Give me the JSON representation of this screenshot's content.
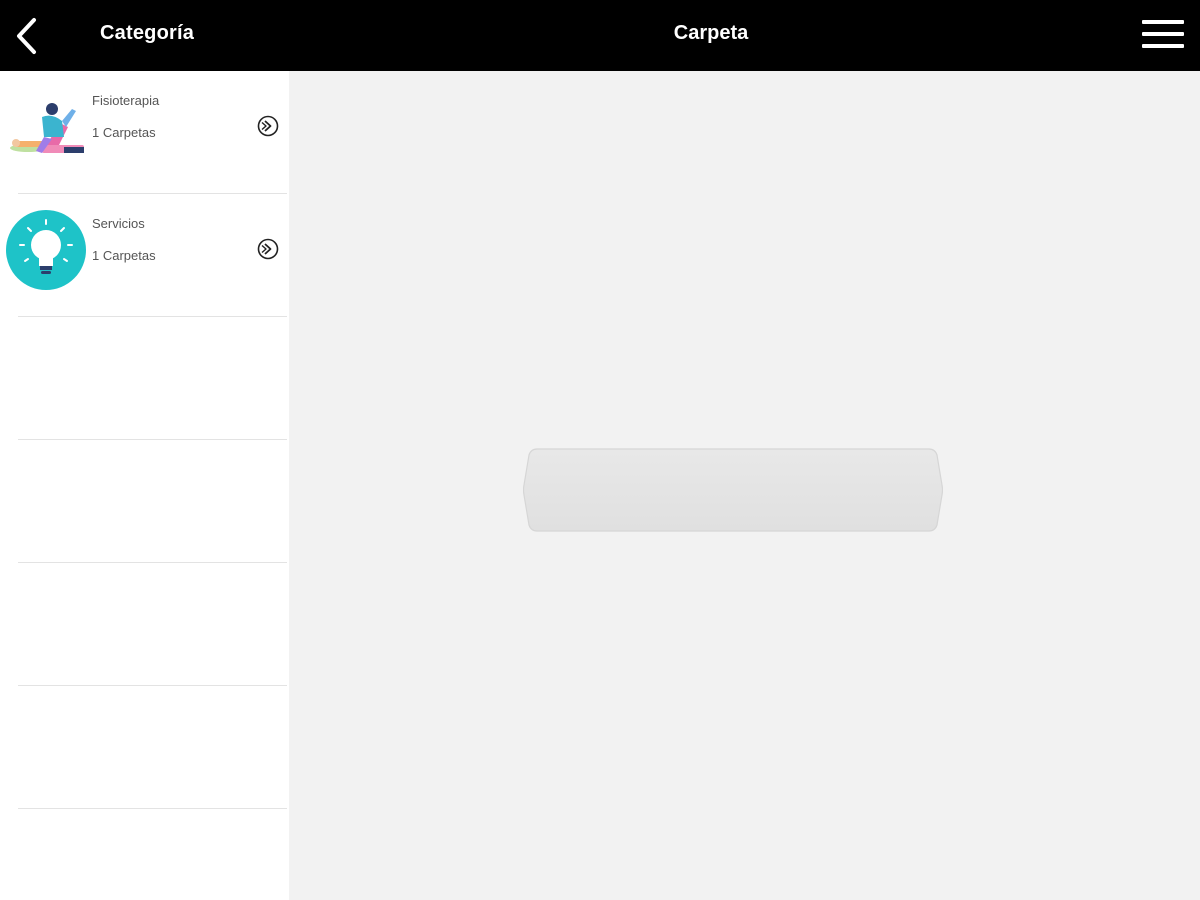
{
  "header": {
    "back_icon": "chevron-left-icon",
    "category_label": "Categoría",
    "title": "Carpeta",
    "menu_icon": "hamburger-menu-icon"
  },
  "categories": [
    {
      "name": "Fisioterapia",
      "count": "1 Carpetas",
      "thumb": "physiotherapy-illustration",
      "action_icon": "circle-chevron-right-icon"
    },
    {
      "name": "Servicios",
      "count": "1 Carpetas",
      "thumb": "lightbulb-icon",
      "action_icon": "circle-chevron-right-icon"
    }
  ],
  "colors": {
    "header_bg": "#000000",
    "sidebar_bg": "#ffffff",
    "main_bg": "#f2f2f2",
    "teal_accent": "#1ec3c8",
    "pill_bg": "#e4e4e4"
  }
}
